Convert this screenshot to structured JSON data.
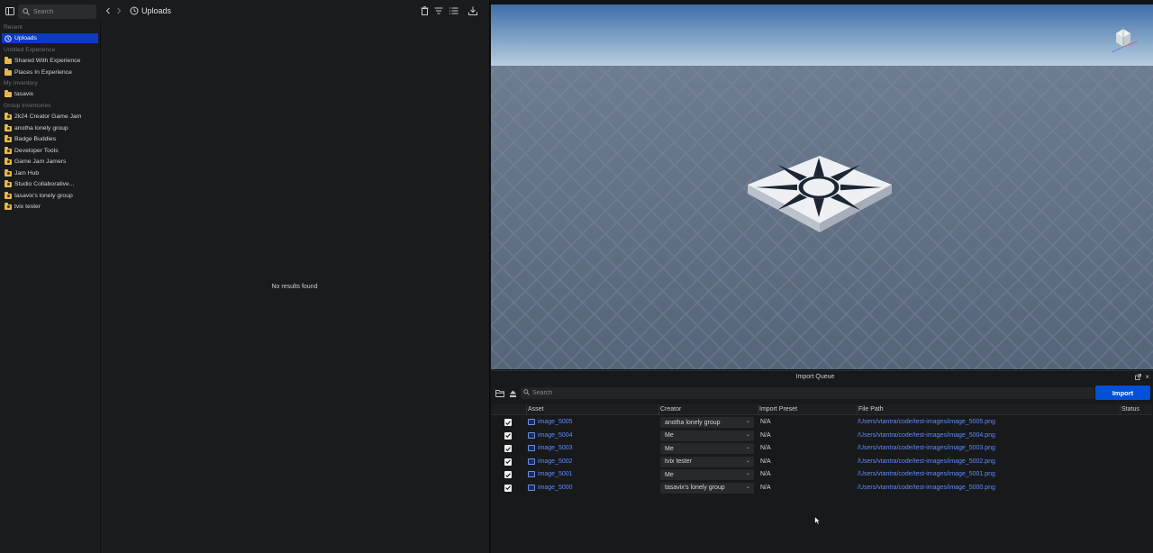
{
  "asset_manager": {
    "search_placeholder": "Search",
    "title": "Uploads",
    "no_results": "No results found",
    "sidebar": {
      "recent_header": "Recent",
      "recent_items": [
        {
          "label": "Uploads",
          "icon": "clock-icon",
          "selected": true
        }
      ],
      "experience_header": "Untitled Experience",
      "experience_items": [
        {
          "label": "Shared With Experience"
        },
        {
          "label": "Places In Experience"
        }
      ],
      "inventory_header": "My Inventory",
      "inventory_items": [
        {
          "label": "tasavix"
        }
      ],
      "group_header": "Group Inventories",
      "group_items": [
        {
          "label": "2k24 Creator Game Jam"
        },
        {
          "label": "anotha lonely group"
        },
        {
          "label": "Badge Buddies"
        },
        {
          "label": "Developer Tools"
        },
        {
          "label": "Game Jam Jamers"
        },
        {
          "label": "Jam Hub"
        },
        {
          "label": "Studio Collaborative..."
        },
        {
          "label": "tasavix's lonely group"
        },
        {
          "label": "tvix tester"
        }
      ]
    }
  },
  "import_queue": {
    "title": "Import Queue",
    "search_placeholder": "Search",
    "import_label": "Import",
    "columns": [
      "Asset",
      "Creator",
      "Import Preset",
      "File Path",
      "Status"
    ],
    "rows": [
      {
        "checked": true,
        "asset": "image_5005",
        "creator": "anotha lonely group",
        "preset": "N/A",
        "path": "/Users/vtantra/code/test-images/image_5005.png",
        "status": ""
      },
      {
        "checked": true,
        "asset": "image_5004",
        "creator": "Me",
        "preset": "N/A",
        "path": "/Users/vtantra/code/test-images/image_5004.png",
        "status": ""
      },
      {
        "checked": true,
        "asset": "image_5003",
        "creator": "Me",
        "preset": "N/A",
        "path": "/Users/vtantra/code/test-images/image_5003.png",
        "status": ""
      },
      {
        "checked": true,
        "asset": "image_5002",
        "creator": "tvix tester",
        "preset": "N/A",
        "path": "/Users/vtantra/code/test-images/image_5002.png",
        "status": ""
      },
      {
        "checked": true,
        "asset": "image_5001",
        "creator": "Me",
        "preset": "N/A",
        "path": "/Users/vtantra/code/test-images/image_5001.png",
        "status": ""
      },
      {
        "checked": true,
        "asset": "image_5000",
        "creator": "tasavix's lonely group",
        "preset": "N/A",
        "path": "/Users/vtantra/code/test-images/image_5000.png",
        "status": ""
      }
    ]
  },
  "viewport": {
    "sky_top": "#3d6ea8",
    "sky_bottom": "#b8cde0",
    "ground": "#5b6a80",
    "part_color": "#e6e8ee",
    "decal_color": "#1c2633",
    "gizmo": {
      "x_color": "#e05b5b",
      "y_color": "#6fc36f",
      "z_color": "#5b7fe0"
    }
  },
  "colors": {
    "accent": "#0c3ac0",
    "import_button": "#0050d8",
    "link": "#5f8bff",
    "folder": "#e8b74a"
  }
}
